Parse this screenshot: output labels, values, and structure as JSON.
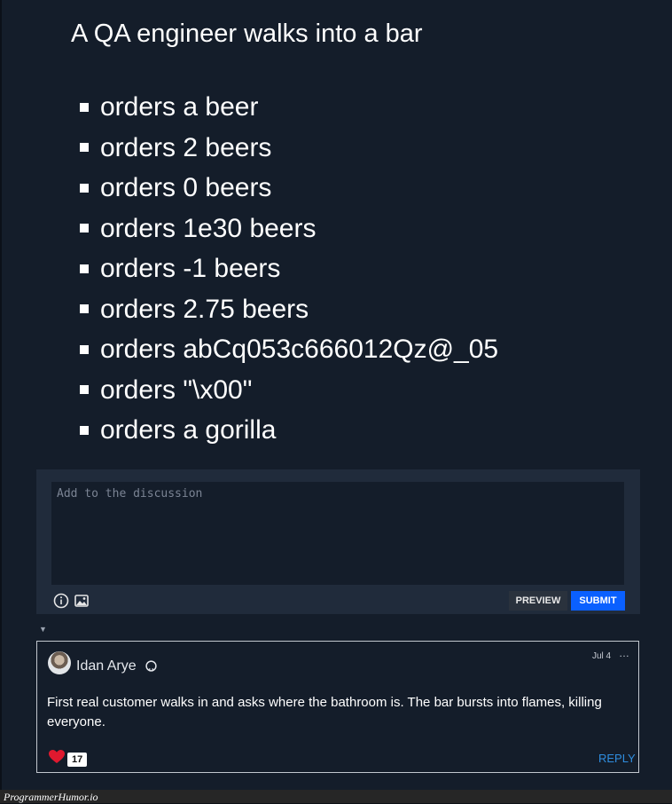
{
  "post": {
    "title": "A QA engineer walks into a bar",
    "items": [
      "orders a beer",
      "orders 2 beers",
      "orders 0 beers",
      "orders 1e30 beers",
      "orders -1 beers",
      "orders 2.75 beers",
      "orders abCq053c666012Qz@_05",
      "orders \"\\x00\"",
      "orders a gorilla"
    ]
  },
  "composer": {
    "placeholder": "Add to the discussion",
    "value": "",
    "preview_label": "PREVIEW",
    "submit_label": "SUBMIT"
  },
  "comment": {
    "author": "Idan Arye",
    "date": "Jul 4",
    "more_icon": "…",
    "body": "First real customer walks in and asks where the bathroom is. The bar bursts into flames, killing everyone.",
    "likes": "17",
    "reply_label": "REPLY"
  },
  "footer": {
    "watermark": "ProgrammerHumor.io"
  },
  "icons": {
    "info": "info-icon",
    "image": "image-icon",
    "github": "github-icon",
    "heart": "heart-icon",
    "collapse": "▼"
  },
  "colors": {
    "background": "#141d2a",
    "composer": "#202b3b",
    "submit": "#0a60ff",
    "reply": "#2f8ddf",
    "heart": "#e0192f"
  }
}
